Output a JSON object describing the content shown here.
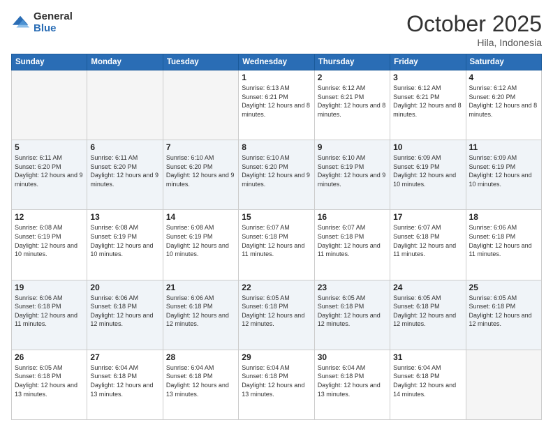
{
  "header": {
    "logo_general": "General",
    "logo_blue": "Blue",
    "month_title": "October 2025",
    "location": "Hila, Indonesia"
  },
  "calendar": {
    "days_of_week": [
      "Sunday",
      "Monday",
      "Tuesday",
      "Wednesday",
      "Thursday",
      "Friday",
      "Saturday"
    ],
    "weeks": [
      [
        {
          "day": "",
          "sunrise": "",
          "sunset": "",
          "daylight": "",
          "empty": true
        },
        {
          "day": "",
          "sunrise": "",
          "sunset": "",
          "daylight": "",
          "empty": true
        },
        {
          "day": "",
          "sunrise": "",
          "sunset": "",
          "daylight": "",
          "empty": true
        },
        {
          "day": "1",
          "sunrise": "Sunrise: 6:13 AM",
          "sunset": "Sunset: 6:21 PM",
          "daylight": "Daylight: 12 hours and 8 minutes.",
          "empty": false
        },
        {
          "day": "2",
          "sunrise": "Sunrise: 6:12 AM",
          "sunset": "Sunset: 6:21 PM",
          "daylight": "Daylight: 12 hours and 8 minutes.",
          "empty": false
        },
        {
          "day": "3",
          "sunrise": "Sunrise: 6:12 AM",
          "sunset": "Sunset: 6:21 PM",
          "daylight": "Daylight: 12 hours and 8 minutes.",
          "empty": false
        },
        {
          "day": "4",
          "sunrise": "Sunrise: 6:12 AM",
          "sunset": "Sunset: 6:20 PM",
          "daylight": "Daylight: 12 hours and 8 minutes.",
          "empty": false
        }
      ],
      [
        {
          "day": "5",
          "sunrise": "Sunrise: 6:11 AM",
          "sunset": "Sunset: 6:20 PM",
          "daylight": "Daylight: 12 hours and 9 minutes.",
          "empty": false
        },
        {
          "day": "6",
          "sunrise": "Sunrise: 6:11 AM",
          "sunset": "Sunset: 6:20 PM",
          "daylight": "Daylight: 12 hours and 9 minutes.",
          "empty": false
        },
        {
          "day": "7",
          "sunrise": "Sunrise: 6:10 AM",
          "sunset": "Sunset: 6:20 PM",
          "daylight": "Daylight: 12 hours and 9 minutes.",
          "empty": false
        },
        {
          "day": "8",
          "sunrise": "Sunrise: 6:10 AM",
          "sunset": "Sunset: 6:20 PM",
          "daylight": "Daylight: 12 hours and 9 minutes.",
          "empty": false
        },
        {
          "day": "9",
          "sunrise": "Sunrise: 6:10 AM",
          "sunset": "Sunset: 6:19 PM",
          "daylight": "Daylight: 12 hours and 9 minutes.",
          "empty": false
        },
        {
          "day": "10",
          "sunrise": "Sunrise: 6:09 AM",
          "sunset": "Sunset: 6:19 PM",
          "daylight": "Daylight: 12 hours and 10 minutes.",
          "empty": false
        },
        {
          "day": "11",
          "sunrise": "Sunrise: 6:09 AM",
          "sunset": "Sunset: 6:19 PM",
          "daylight": "Daylight: 12 hours and 10 minutes.",
          "empty": false
        }
      ],
      [
        {
          "day": "12",
          "sunrise": "Sunrise: 6:08 AM",
          "sunset": "Sunset: 6:19 PM",
          "daylight": "Daylight: 12 hours and 10 minutes.",
          "empty": false
        },
        {
          "day": "13",
          "sunrise": "Sunrise: 6:08 AM",
          "sunset": "Sunset: 6:19 PM",
          "daylight": "Daylight: 12 hours and 10 minutes.",
          "empty": false
        },
        {
          "day": "14",
          "sunrise": "Sunrise: 6:08 AM",
          "sunset": "Sunset: 6:19 PM",
          "daylight": "Daylight: 12 hours and 10 minutes.",
          "empty": false
        },
        {
          "day": "15",
          "sunrise": "Sunrise: 6:07 AM",
          "sunset": "Sunset: 6:18 PM",
          "daylight": "Daylight: 12 hours and 11 minutes.",
          "empty": false
        },
        {
          "day": "16",
          "sunrise": "Sunrise: 6:07 AM",
          "sunset": "Sunset: 6:18 PM",
          "daylight": "Daylight: 12 hours and 11 minutes.",
          "empty": false
        },
        {
          "day": "17",
          "sunrise": "Sunrise: 6:07 AM",
          "sunset": "Sunset: 6:18 PM",
          "daylight": "Daylight: 12 hours and 11 minutes.",
          "empty": false
        },
        {
          "day": "18",
          "sunrise": "Sunrise: 6:06 AM",
          "sunset": "Sunset: 6:18 PM",
          "daylight": "Daylight: 12 hours and 11 minutes.",
          "empty": false
        }
      ],
      [
        {
          "day": "19",
          "sunrise": "Sunrise: 6:06 AM",
          "sunset": "Sunset: 6:18 PM",
          "daylight": "Daylight: 12 hours and 11 minutes.",
          "empty": false
        },
        {
          "day": "20",
          "sunrise": "Sunrise: 6:06 AM",
          "sunset": "Sunset: 6:18 PM",
          "daylight": "Daylight: 12 hours and 12 minutes.",
          "empty": false
        },
        {
          "day": "21",
          "sunrise": "Sunrise: 6:06 AM",
          "sunset": "Sunset: 6:18 PM",
          "daylight": "Daylight: 12 hours and 12 minutes.",
          "empty": false
        },
        {
          "day": "22",
          "sunrise": "Sunrise: 6:05 AM",
          "sunset": "Sunset: 6:18 PM",
          "daylight": "Daylight: 12 hours and 12 minutes.",
          "empty": false
        },
        {
          "day": "23",
          "sunrise": "Sunrise: 6:05 AM",
          "sunset": "Sunset: 6:18 PM",
          "daylight": "Daylight: 12 hours and 12 minutes.",
          "empty": false
        },
        {
          "day": "24",
          "sunrise": "Sunrise: 6:05 AM",
          "sunset": "Sunset: 6:18 PM",
          "daylight": "Daylight: 12 hours and 12 minutes.",
          "empty": false
        },
        {
          "day": "25",
          "sunrise": "Sunrise: 6:05 AM",
          "sunset": "Sunset: 6:18 PM",
          "daylight": "Daylight: 12 hours and 12 minutes.",
          "empty": false
        }
      ],
      [
        {
          "day": "26",
          "sunrise": "Sunrise: 6:05 AM",
          "sunset": "Sunset: 6:18 PM",
          "daylight": "Daylight: 12 hours and 13 minutes.",
          "empty": false
        },
        {
          "day": "27",
          "sunrise": "Sunrise: 6:04 AM",
          "sunset": "Sunset: 6:18 PM",
          "daylight": "Daylight: 12 hours and 13 minutes.",
          "empty": false
        },
        {
          "day": "28",
          "sunrise": "Sunrise: 6:04 AM",
          "sunset": "Sunset: 6:18 PM",
          "daylight": "Daylight: 12 hours and 13 minutes.",
          "empty": false
        },
        {
          "day": "29",
          "sunrise": "Sunrise: 6:04 AM",
          "sunset": "Sunset: 6:18 PM",
          "daylight": "Daylight: 12 hours and 13 minutes.",
          "empty": false
        },
        {
          "day": "30",
          "sunrise": "Sunrise: 6:04 AM",
          "sunset": "Sunset: 6:18 PM",
          "daylight": "Daylight: 12 hours and 13 minutes.",
          "empty": false
        },
        {
          "day": "31",
          "sunrise": "Sunrise: 6:04 AM",
          "sunset": "Sunset: 6:18 PM",
          "daylight": "Daylight: 12 hours and 14 minutes.",
          "empty": false
        },
        {
          "day": "",
          "sunrise": "",
          "sunset": "",
          "daylight": "",
          "empty": true
        }
      ]
    ]
  }
}
